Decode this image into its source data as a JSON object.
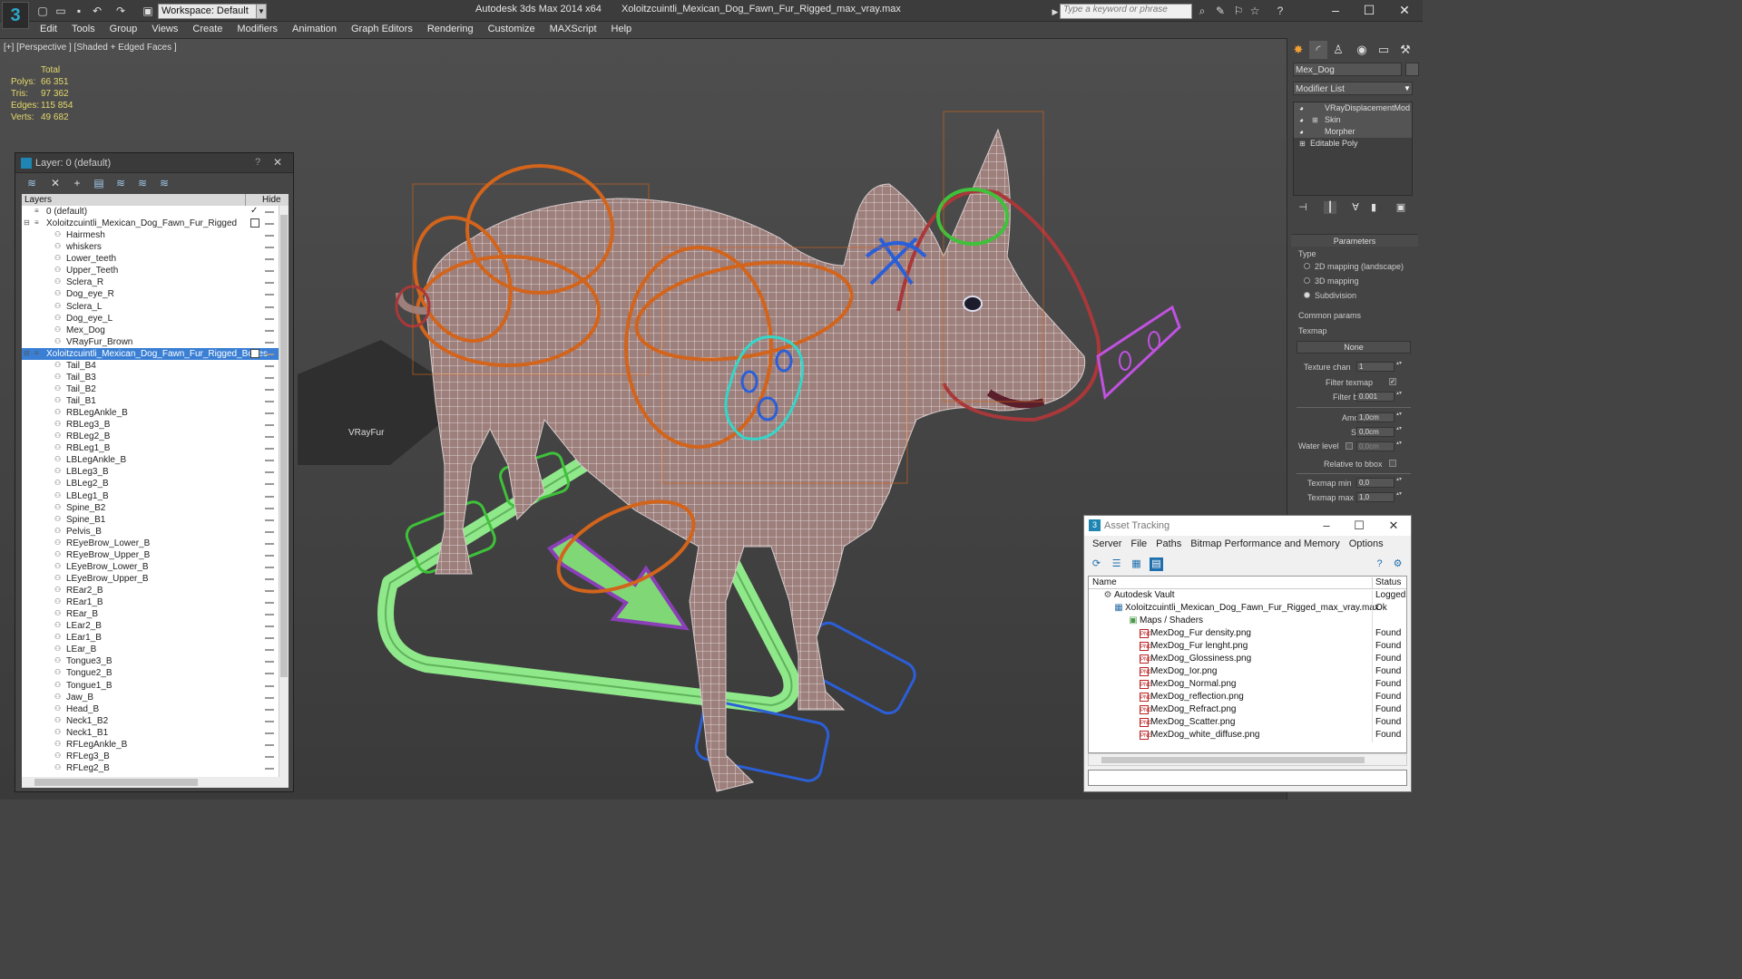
{
  "titlebar": {
    "workspace": "Workspace: Default",
    "app_title": "Autodesk 3ds Max 2014 x64",
    "file_title": "Xoloitzcuintli_Mexican_Dog_Fawn_Fur_Rigged_max_vray.max",
    "search_placeholder": "Type a keyword or phrase"
  },
  "menu": [
    "Edit",
    "Tools",
    "Group",
    "Views",
    "Create",
    "Modifiers",
    "Animation",
    "Graph Editors",
    "Rendering",
    "Customize",
    "MAXScript",
    "Help"
  ],
  "viewport": {
    "label": "[+] [Perspective ] [Shaded + Edged Faces ]",
    "stats_header": "Total",
    "stats": [
      {
        "k": "Polys:",
        "v": "66 351"
      },
      {
        "k": "Tris:",
        "v": "97 362"
      },
      {
        "k": "Edges:",
        "v": "115 854"
      },
      {
        "k": "Verts:",
        "v": "49 682"
      }
    ],
    "fur_label": "VRayFur"
  },
  "layer_panel": {
    "title": "Layer: 0 (default)",
    "help": "?",
    "close": "✕",
    "col_layers": "Layers",
    "col_hide": "Hide",
    "rows": [
      {
        "name": "0 (default)",
        "indent": 0,
        "kind": "layer",
        "check": true
      },
      {
        "name": "Xoloitzcuintli_Mexican_Dog_Fawn_Fur_Rigged",
        "indent": 0,
        "kind": "layer-root",
        "box": true
      },
      {
        "name": "Hairmesh",
        "indent": 1,
        "kind": "obj"
      },
      {
        "name": "whiskers",
        "indent": 1,
        "kind": "obj"
      },
      {
        "name": "Lower_teeth",
        "indent": 1,
        "kind": "obj"
      },
      {
        "name": "Upper_Teeth",
        "indent": 1,
        "kind": "obj"
      },
      {
        "name": "Sclera_R",
        "indent": 1,
        "kind": "obj"
      },
      {
        "name": "Dog_eye_R",
        "indent": 1,
        "kind": "obj"
      },
      {
        "name": "Sclera_L",
        "indent": 1,
        "kind": "obj"
      },
      {
        "name": "Dog_eye_L",
        "indent": 1,
        "kind": "obj"
      },
      {
        "name": "Mex_Dog",
        "indent": 1,
        "kind": "obj"
      },
      {
        "name": "VRayFur_Brown",
        "indent": 1,
        "kind": "obj"
      },
      {
        "name": "Xoloitzcuintli_Mexican_Dog_Fawn_Fur_Rigged_Bones",
        "indent": 0,
        "kind": "layer-root",
        "box": true,
        "selected": true
      },
      {
        "name": "Tail_B4",
        "indent": 1,
        "kind": "obj"
      },
      {
        "name": "Tail_B3",
        "indent": 1,
        "kind": "obj"
      },
      {
        "name": "Tail_B2",
        "indent": 1,
        "kind": "obj"
      },
      {
        "name": "Tail_B1",
        "indent": 1,
        "kind": "obj"
      },
      {
        "name": "RBLegAnkle_B",
        "indent": 1,
        "kind": "obj"
      },
      {
        "name": "RBLeg3_B",
        "indent": 1,
        "kind": "obj"
      },
      {
        "name": "RBLeg2_B",
        "indent": 1,
        "kind": "obj"
      },
      {
        "name": "RBLeg1_B",
        "indent": 1,
        "kind": "obj"
      },
      {
        "name": "LBLegAnkle_B",
        "indent": 1,
        "kind": "obj"
      },
      {
        "name": "LBLeg3_B",
        "indent": 1,
        "kind": "obj"
      },
      {
        "name": "LBLeg2_B",
        "indent": 1,
        "kind": "obj"
      },
      {
        "name": "LBLeg1_B",
        "indent": 1,
        "kind": "obj"
      },
      {
        "name": "Spine_B2",
        "indent": 1,
        "kind": "obj"
      },
      {
        "name": "Spine_B1",
        "indent": 1,
        "kind": "obj"
      },
      {
        "name": "Pelvis_B",
        "indent": 1,
        "kind": "obj"
      },
      {
        "name": "REyeBrow_Lower_B",
        "indent": 1,
        "kind": "obj"
      },
      {
        "name": "REyeBrow_Upper_B",
        "indent": 1,
        "kind": "obj"
      },
      {
        "name": "LEyeBrow_Lower_B",
        "indent": 1,
        "kind": "obj"
      },
      {
        "name": "LEyeBrow_Upper_B",
        "indent": 1,
        "kind": "obj"
      },
      {
        "name": "REar2_B",
        "indent": 1,
        "kind": "obj"
      },
      {
        "name": "REar1_B",
        "indent": 1,
        "kind": "obj"
      },
      {
        "name": "REar_B",
        "indent": 1,
        "kind": "obj"
      },
      {
        "name": "LEar2_B",
        "indent": 1,
        "kind": "obj"
      },
      {
        "name": "LEar1_B",
        "indent": 1,
        "kind": "obj"
      },
      {
        "name": "LEar_B",
        "indent": 1,
        "kind": "obj"
      },
      {
        "name": "Tongue3_B",
        "indent": 1,
        "kind": "obj"
      },
      {
        "name": "Tongue2_B",
        "indent": 1,
        "kind": "obj"
      },
      {
        "name": "Tongue1_B",
        "indent": 1,
        "kind": "obj"
      },
      {
        "name": "Jaw_B",
        "indent": 1,
        "kind": "obj"
      },
      {
        "name": "Head_B",
        "indent": 1,
        "kind": "obj"
      },
      {
        "name": "Neck1_B2",
        "indent": 1,
        "kind": "obj"
      },
      {
        "name": "Neck1_B1",
        "indent": 1,
        "kind": "obj"
      },
      {
        "name": "RFLegAnkle_B",
        "indent": 1,
        "kind": "obj"
      },
      {
        "name": "RFLeg3_B",
        "indent": 1,
        "kind": "obj"
      },
      {
        "name": "RFLeg2_B",
        "indent": 1,
        "kind": "obj"
      }
    ]
  },
  "command_panel": {
    "object_name": "Mex_Dog",
    "modifier_list": "Modifier List",
    "stack": [
      {
        "name": "VRayDisplacementMod",
        "plus": false
      },
      {
        "name": "Skin",
        "plus": true
      },
      {
        "name": "Morpher",
        "plus": false
      },
      {
        "name": "Editable Poly",
        "plus": true
      }
    ],
    "params_title": "Parameters",
    "type_label": "Type",
    "type_options": [
      {
        "label": "2D mapping (landscape)",
        "selected": false
      },
      {
        "label": "3D mapping",
        "selected": false
      },
      {
        "label": "Subdivision",
        "selected": true
      }
    ],
    "common_params": "Common params",
    "texmap_label": "Texmap",
    "texmap_value": "None",
    "texture_chan_label": "Texture chan",
    "texture_chan_value": "1",
    "filter_texmap_label": "Filter texmap",
    "filter_blur_label": "Filter blur",
    "filter_blur_value": "0.001",
    "amount_label": "Amount",
    "amount_value": "1,0cm",
    "shift_label": "Shift",
    "shift_value": "0,0cm",
    "water_level_label": "Water level",
    "water_level_value": "0,0cm",
    "relative_bbox_label": "Relative to bbox",
    "texmap_min_label": "Texmap min",
    "texmap_min_value": "0,0",
    "texmap_max_label": "Texmap max",
    "texmap_max_value": "1,0"
  },
  "asset_tracking": {
    "title": "Asset Tracking",
    "menu": [
      "Server",
      "File",
      "Paths",
      "Bitmap Performance and Memory",
      "Options"
    ],
    "col_name": "Name",
    "col_status": "Status",
    "rows": [
      {
        "name": "Autodesk Vault",
        "status": "Logged O",
        "indent": 0,
        "icon": "vault"
      },
      {
        "name": "Xoloitzcuintli_Mexican_Dog_Fawn_Fur_Rigged_max_vray.max",
        "status": "Ok",
        "indent": 1,
        "icon": "max"
      },
      {
        "name": "Maps / Shaders",
        "status": "",
        "indent": 2,
        "icon": "folder"
      },
      {
        "name": "MexDog_Fur density.png",
        "status": "Found",
        "indent": 3,
        "icon": "png"
      },
      {
        "name": "MexDog_Fur lenght.png",
        "status": "Found",
        "indent": 3,
        "icon": "png"
      },
      {
        "name": "MexDog_Glossiness.png",
        "status": "Found",
        "indent": 3,
        "icon": "png"
      },
      {
        "name": "MexDog_Ior.png",
        "status": "Found",
        "indent": 3,
        "icon": "png"
      },
      {
        "name": "MexDog_Normal.png",
        "status": "Found",
        "indent": 3,
        "icon": "png"
      },
      {
        "name": "MexDog_reflection.png",
        "status": "Found",
        "indent": 3,
        "icon": "png"
      },
      {
        "name": "MexDog_Refract.png",
        "status": "Found",
        "indent": 3,
        "icon": "png"
      },
      {
        "name": "MexDog_Scatter.png",
        "status": "Found",
        "indent": 3,
        "icon": "png"
      },
      {
        "name": "MexDog_white_diffuse.png",
        "status": "Found",
        "indent": 3,
        "icon": "png"
      }
    ]
  },
  "colors": {
    "rig_orange": "#d2641c",
    "rig_green": "#8fe88a",
    "rig_purple": "#a04bd6",
    "rig_red": "#a8383a",
    "rig_blue": "#2b5fd8",
    "rig_cyan": "#35d6c8",
    "mesh_fill": "#9c7c7a"
  }
}
